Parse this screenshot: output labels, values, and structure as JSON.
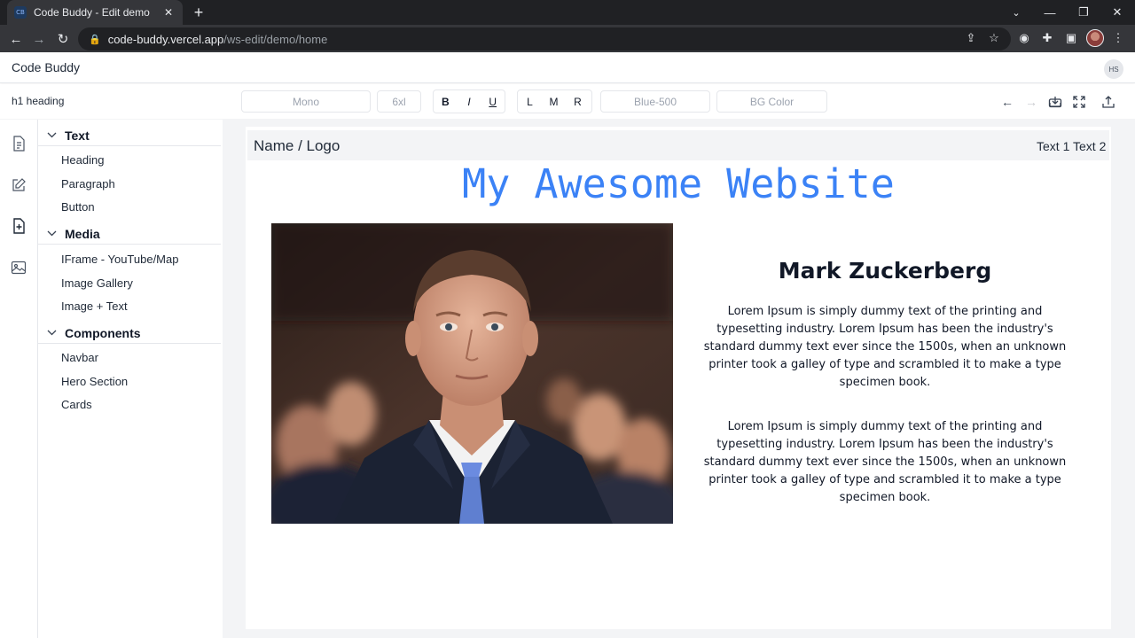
{
  "browser": {
    "tab_title": "Code Buddy - Edit demo",
    "tab_favicon": "CB",
    "tab_close": "✕",
    "new_tab": "+",
    "url_host": "code-buddy.vercel.app",
    "url_path": "/ws-edit/demo/home"
  },
  "app": {
    "title": "Code Buddy",
    "user_initials": "HS"
  },
  "editor_bar": {
    "selected_element": "h1 heading",
    "font_family": "Mono",
    "font_size": "6xl",
    "bold": "B",
    "italic": "I",
    "underline": "U",
    "align_left": "L",
    "align_middle": "M",
    "align_right": "R",
    "text_color": "Blue-500",
    "bg_color": "BG Color"
  },
  "panel": {
    "sections": [
      {
        "label": "Text",
        "items": [
          "Heading",
          "Paragraph",
          "Button"
        ]
      },
      {
        "label": "Media",
        "items": [
          "IFrame - YouTube/Map",
          "Image Gallery",
          "Image + Text"
        ]
      },
      {
        "label": "Components",
        "items": [
          "Navbar",
          "Hero Section",
          "Cards"
        ]
      }
    ]
  },
  "site": {
    "logo": "Name / Logo",
    "links": [
      "Text 1",
      "Text 2"
    ],
    "heading": "My Awesome Website",
    "hero_name": "Mark Zuckerberg",
    "paragraphs": [
      "Lorem Ipsum is simply dummy text of the printing and typesetting industry. Lorem Ipsum has been the industry's standard dummy text ever since the 1500s, when an unknown printer took a galley of type and scrambled it to make a type specimen book.",
      "Lorem Ipsum is simply dummy text of the printing and typesetting industry. Lorem Ipsum has been the industry's standard dummy text ever since the 1500s, when an unknown printer took a galley of type and scrambled it to make a type specimen book."
    ]
  },
  "colors": {
    "heading_accent": "#3b82f6",
    "canvas_bg": "#f3f4f6"
  },
  "icons": {
    "rail": [
      "document-icon",
      "edit-icon",
      "add-file-icon",
      "image-icon"
    ],
    "toolbar_right": [
      "undo-arrow-icon",
      "redo-arrow-icon",
      "download-icon",
      "fullscreen-icon",
      "upload-icon"
    ]
  }
}
